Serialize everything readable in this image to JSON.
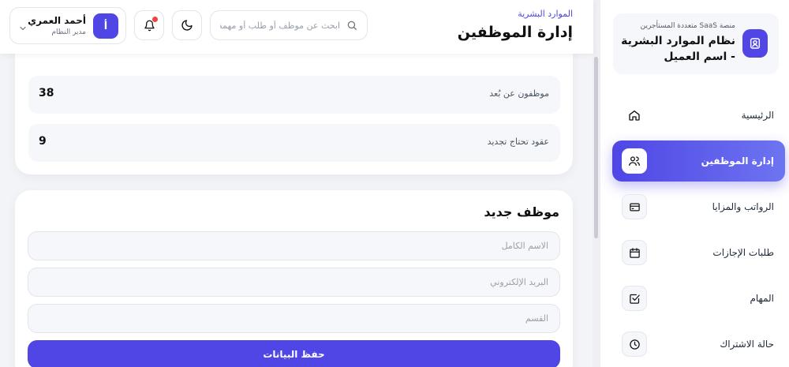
{
  "sidebar": {
    "brand": {
      "subtitle": "منصة SaaS متعددة المستأجرين",
      "title": "نظام الموارد البشرية - اسم العميل"
    },
    "items": [
      {
        "label": "الرئيسية",
        "icon": "home-icon"
      },
      {
        "label": "إدارة الموظفين",
        "icon": "users-icon",
        "active": true
      },
      {
        "label": "الرواتب والمزايا",
        "icon": "credit-card-icon"
      },
      {
        "label": "طلبات الإجازات",
        "icon": "calendar-icon"
      },
      {
        "label": "المهام",
        "icon": "checkbox-icon"
      },
      {
        "label": "حالة الاشتراك",
        "icon": "clock-icon"
      }
    ]
  },
  "header": {
    "breadcrumb": "الموارد البشرية",
    "title": "إدارة الموظفين",
    "search_placeholder": "ابحث عن موظف أو طلب أو مهمة...",
    "user": {
      "name": "أحمد العمري",
      "role": "مدير النظام",
      "initial": "أ"
    }
  },
  "stats": [
    {
      "label": "موظفون عن بُعد",
      "value": "38"
    },
    {
      "label": "عقود تحتاج تجديد",
      "value": "9"
    }
  ],
  "form": {
    "title": "موظف جديد",
    "fields": [
      {
        "placeholder": "الاسم الكامل"
      },
      {
        "placeholder": "البريد الإلكتروني"
      },
      {
        "placeholder": "القسم"
      }
    ],
    "submit_label": "حفظ البيانات"
  },
  "colors": {
    "accent": "#4f46e5",
    "notification": "#ef4444"
  }
}
